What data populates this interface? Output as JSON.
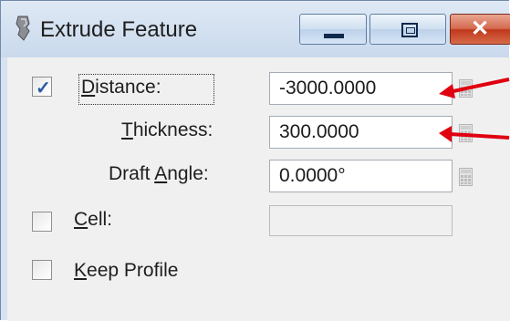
{
  "window": {
    "title": "Extrude Feature",
    "controls": {
      "minimize": "minimize",
      "maximize": "maximize",
      "close": "✕"
    }
  },
  "form": {
    "distance": {
      "checked": true,
      "label_u": "D",
      "label_rest": "istance:",
      "value": "-3000.0000"
    },
    "thickness": {
      "label_pre": "",
      "label_u": "T",
      "label_rest": "hickness:",
      "value": "300.0000"
    },
    "draft_angle": {
      "label_pre": "Draft ",
      "label_u": "A",
      "label_rest": "ngle:",
      "value": "0.0000°"
    },
    "cell": {
      "checked": false,
      "label_u": "C",
      "label_rest": "ell:",
      "value": ""
    },
    "keep_profile": {
      "checked": false,
      "label_u": "K",
      "label_rest": "eep Profile"
    }
  },
  "annotations": {
    "arrow_color": "#e0000f"
  }
}
